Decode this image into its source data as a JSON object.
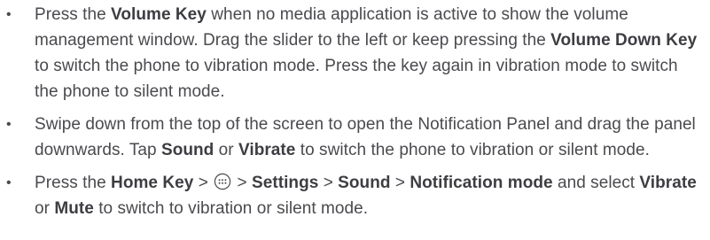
{
  "items": [
    {
      "bullet": "•",
      "t1": "Press the ",
      "b1": "Volume Key",
      "t2": " when no media application is active to show the volume management window. Drag the slider to the left or keep pressing the ",
      "b2": "Volume Down Key",
      "t3": " to switch the phone to vibration mode. Press the key again in vibration mode to switch the phone to silent mode."
    },
    {
      "bullet": "•",
      "t1": "Swipe down from the top of the screen to open the Notification Panel and drag the panel downwards. Tap ",
      "b1": "Sound",
      "t2": " or ",
      "b2": "Vibrate",
      "t3": " to switch the phone to vibration or silent mode."
    },
    {
      "bullet": "•",
      "t1": "Press the ",
      "b1": "Home Key",
      "sep1": " > ",
      "icon": "apps-grid-icon",
      "sep2": " > ",
      "b2": "Settings",
      "sep3": " > ",
      "b3": "Sound",
      "sep4": " > ",
      "b4": "Notification mode",
      "t2": " and select ",
      "b5": "Vibrate",
      "t3": " or ",
      "b6": "Mute",
      "t4": " to switch to vibration or silent mode."
    }
  ]
}
